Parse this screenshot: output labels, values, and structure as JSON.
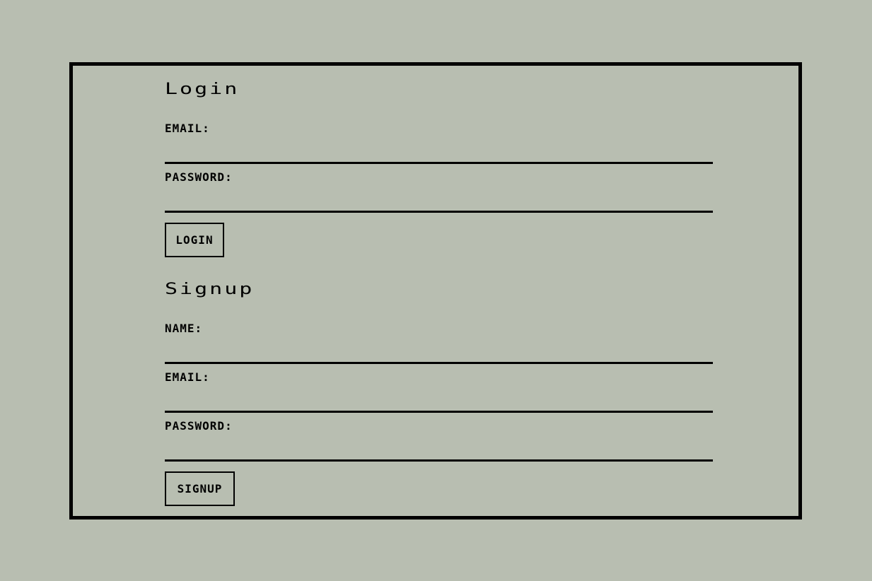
{
  "login": {
    "title": "Login",
    "email_label": "Email:",
    "email_value": "",
    "password_label": "Password:",
    "password_value": "",
    "button_label": "Login"
  },
  "signup": {
    "title": "Signup",
    "name_label": "Name:",
    "name_value": "",
    "email_label": "Email:",
    "email_value": "",
    "password_label": "Password:",
    "password_value": "",
    "button_label": "Signup"
  }
}
